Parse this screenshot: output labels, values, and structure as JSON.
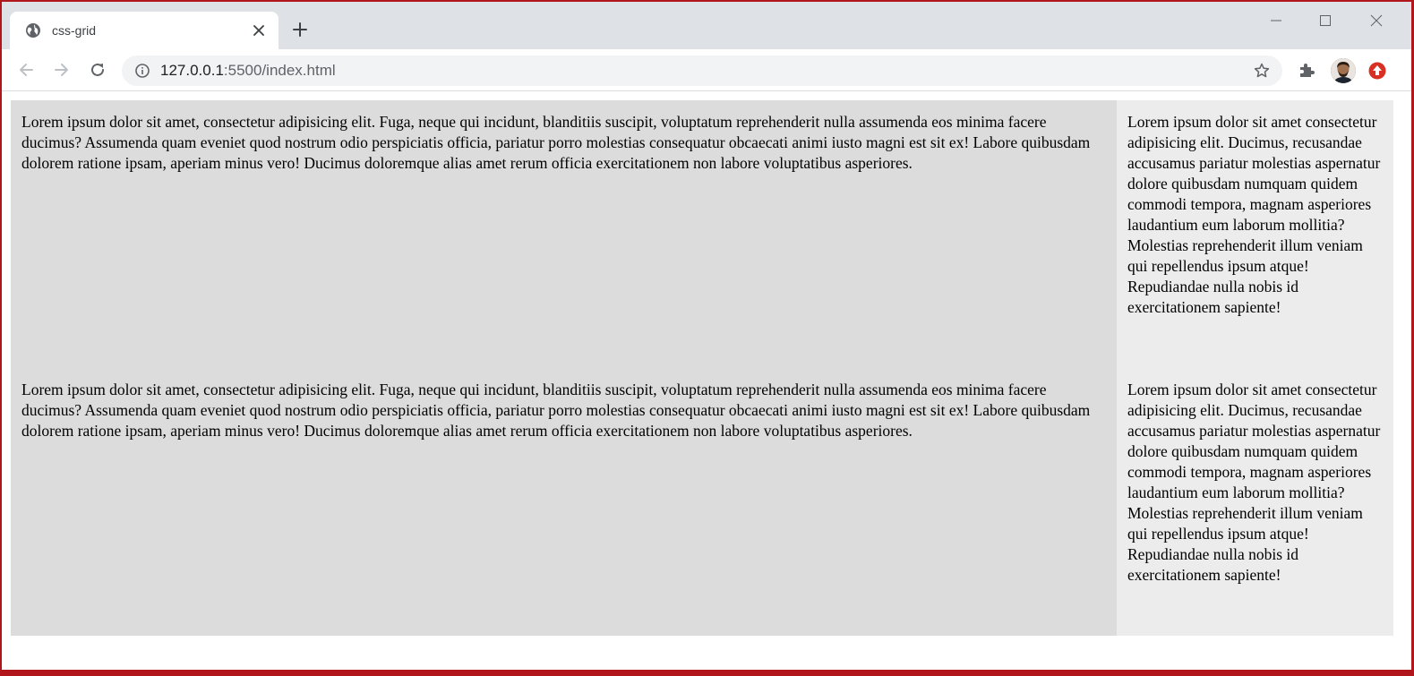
{
  "browser": {
    "tab": {
      "title": "css-grid"
    },
    "address": {
      "host": "127.0.0.1",
      "path": ":5500/index.html"
    },
    "icons": [
      "globe-icon",
      "close-icon",
      "plus-icon",
      "minimize-icon",
      "maximize-icon",
      "window-close-icon",
      "back-arrow-icon",
      "forward-arrow-icon",
      "reload-icon",
      "info-icon",
      "star-icon",
      "puzzle-icon",
      "update-icon"
    ]
  },
  "page": {
    "rows": [
      {
        "main": "Lorem ipsum dolor sit amet, consectetur adipisicing elit. Fuga, neque qui incidunt, blanditiis suscipit, voluptatum reprehenderit nulla assumenda eos minima facere ducimus? Assumenda quam eveniet quod nostrum odio perspiciatis officia, pariatur porro molestias consequatur obcaecati animi iusto magni est sit ex! Labore quibusdam dolorem ratione ipsam, aperiam minus vero! Ducimus doloremque alias amet rerum officia exercitationem non labore voluptatibus asperiores.",
        "side": "Lorem ipsum dolor sit amet consectetur adipisicing elit. Ducimus, recusandae accusamus pariatur molestias aspernatur dolore quibusdam numquam quidem commodi tempora, magnam asperiores laudantium eum laborum mollitia? Molestias reprehenderit illum veniam qui repellendus ipsum atque! Repudiandae nulla nobis id exercitationem sapiente!"
      },
      {
        "main": "Lorem ipsum dolor sit amet, consectetur adipisicing elit. Fuga, neque qui incidunt, blanditiis suscipit, voluptatum reprehenderit nulla assumenda eos minima facere ducimus? Assumenda quam eveniet quod nostrum odio perspiciatis officia, pariatur porro molestias consequatur obcaecati animi iusto magni est sit ex! Labore quibusdam dolorem ratione ipsam, aperiam minus vero! Ducimus doloremque alias amet rerum officia exercitationem non labore voluptatibus asperiores.",
        "side": "Lorem ipsum dolor sit amet consectetur adipisicing elit. Ducimus, recusandae accusamus pariatur molestias aspernatur dolore quibusdam numquam quidem commodi tempora, magnam asperiores laudantium eum laborum mollitia? Molestias reprehenderit illum veniam qui repellendus ipsum atque! Repudiandae nulla nobis id exercitationem sapiente!"
      }
    ]
  }
}
